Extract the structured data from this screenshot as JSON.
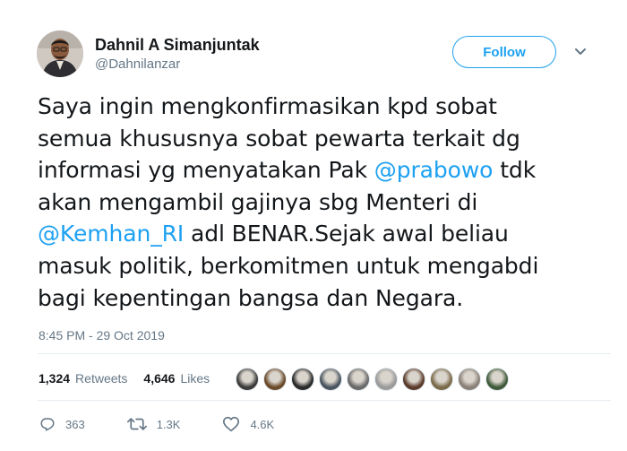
{
  "author": {
    "name": "Dahnil A Simanjuntak",
    "handle": "@Dahnilanzar"
  },
  "follow_button": {
    "label": "Follow"
  },
  "tweet": {
    "lines": [
      [
        {
          "text": "Saya ingin mengkonfirmasikan kpd sobat"
        }
      ],
      [
        {
          "text": "semua khususnya sobat pewarta terkait dg"
        }
      ],
      [
        {
          "text": "informasi yg menyatakan Pak "
        },
        {
          "text": "@prabowo",
          "mention": true
        },
        {
          "text": " tdk"
        }
      ],
      [
        {
          "text": "akan mengambil gajinya sbg Menteri di"
        }
      ],
      [
        {
          "text": "@Kemhan_RI",
          "mention": true
        },
        {
          "text": " adl BENAR.Sejak awal beliau"
        }
      ],
      [
        {
          "text": "masuk politik, berkomitmen untuk mengabdi"
        }
      ],
      [
        {
          "text": "bagi kepentingan bangsa dan Negara."
        }
      ]
    ],
    "timestamp": "8:45 PM - 29 Oct 2019"
  },
  "stats": {
    "retweets_count": "1,324",
    "retweets_label": "Retweets",
    "likes_count": "4,646",
    "likes_label": "Likes"
  },
  "likers": [
    {
      "icon": "liker-avatar",
      "color": "#3b3b3b"
    },
    {
      "icon": "liker-avatar",
      "color": "#6b4a2b"
    },
    {
      "icon": "liker-avatar",
      "color": "#2a2a2a"
    },
    {
      "icon": "liker-avatar",
      "color": "#4a5560"
    },
    {
      "icon": "liker-avatar",
      "color": "#6a6a6a"
    },
    {
      "icon": "liker-avatar",
      "color": "#9a9a9a"
    },
    {
      "icon": "liker-avatar",
      "color": "#5a3a2a"
    },
    {
      "icon": "liker-avatar",
      "color": "#7b6a4a"
    },
    {
      "icon": "liker-avatar",
      "color": "#8a8078"
    },
    {
      "icon": "liker-avatar",
      "color": "#3f5a3a"
    }
  ],
  "actions": {
    "reply_count": "363",
    "retweet_count": "1.3K",
    "like_count": "4.6K"
  },
  "colors": {
    "accent": "#1da1f2",
    "muted": "#657786",
    "text": "#14171a",
    "divider": "#e6ecf0"
  }
}
